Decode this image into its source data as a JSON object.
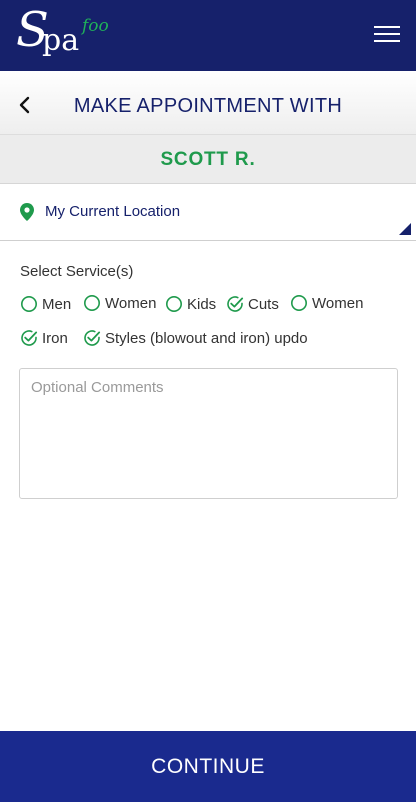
{
  "brand": {
    "logo_text": "Spafoo",
    "accent": "#1fb15a",
    "primary": "#16216b"
  },
  "header": {
    "menu_icon": "hamburger-menu-icon"
  },
  "subheader": {
    "title": "MAKE APPOINTMENT WITH",
    "back_icon": "chevron-left-icon"
  },
  "provider": {
    "name": "SCOTT R."
  },
  "location": {
    "label": "My Current Location",
    "icon": "map-pin-icon"
  },
  "services": {
    "heading": "Select Service(s)",
    "options": [
      {
        "label": "Men",
        "checked": false
      },
      {
        "label": "Women",
        "checked": false
      },
      {
        "label": "Kids",
        "checked": false
      },
      {
        "label": "Cuts",
        "checked": true
      },
      {
        "label": "Women",
        "checked": false
      },
      {
        "label": "Iron",
        "checked": true
      },
      {
        "label": "Styles (blowout and iron) updo",
        "checked": true
      }
    ]
  },
  "comments": {
    "placeholder": "Optional Comments",
    "value": ""
  },
  "footer": {
    "continue_label": "CONTINUE"
  }
}
